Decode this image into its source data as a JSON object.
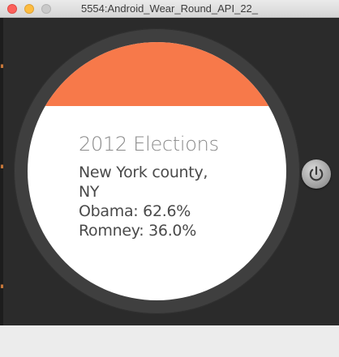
{
  "window": {
    "title": "5554:Android_Wear_Round_API_22_"
  },
  "watch": {
    "header_color": "#f7794a",
    "card": {
      "title": "2012 Elections",
      "lines": [
        "New York county,",
        "NY",
        "Obama: 62.6%",
        "Romney: 36.0%"
      ]
    }
  },
  "controls": {
    "power_icon": "power-icon"
  },
  "colors": {
    "close": "#fc605b",
    "minimize": "#fdbc40",
    "zoom": "#c9c9c9",
    "emulator_background": "#2b2b2b",
    "bezel": "#3f3f3f"
  }
}
